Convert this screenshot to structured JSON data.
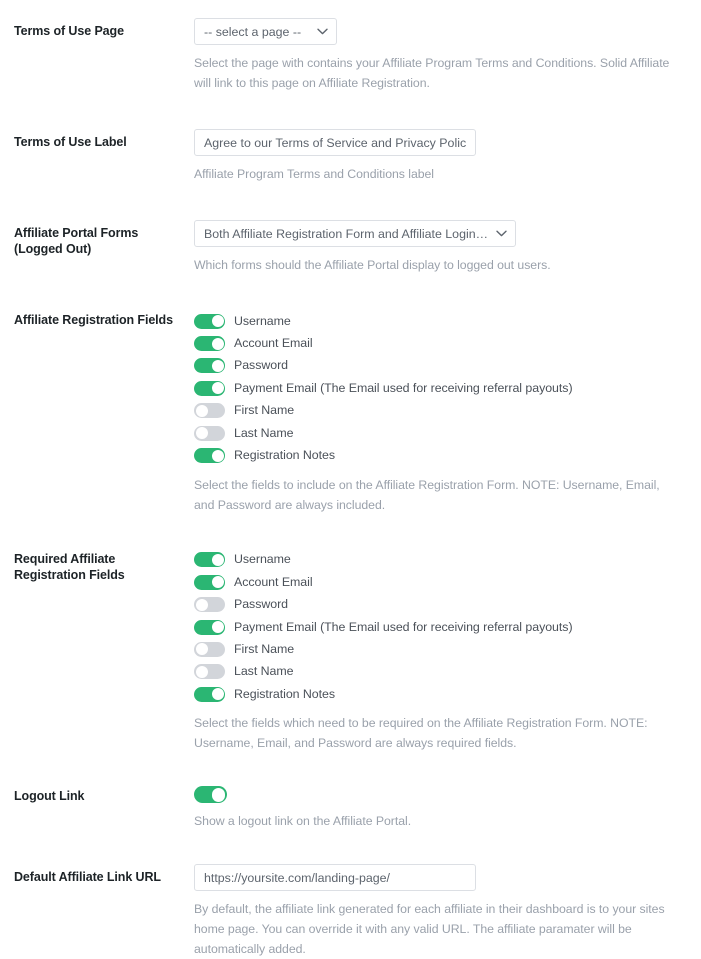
{
  "colors": {
    "toggle_on": "#2bb673",
    "toggle_off": "#d2d5da",
    "label": "#1d2327",
    "description": "#9aa1ab",
    "border": "#dcdfe4"
  },
  "fields": {
    "terms_of_use_page": {
      "label": "Terms of Use Page",
      "select_value": "-- select a page --",
      "description": "Select the page with contains your Affiliate Program Terms and Conditions. Solid Affiliate will link to this page on Affiliate Registration."
    },
    "terms_of_use_label": {
      "label": "Terms of Use Label",
      "value": "Agree to our Terms of Service and Privacy Policy",
      "description": "Affiliate Program Terms and Conditions label"
    },
    "affiliate_portal_forms": {
      "label": "Affiliate Portal Forms (Logged Out)",
      "label_line1": "Affiliate Portal Forms",
      "label_line2": "(Logged Out)",
      "select_value": "Both Affiliate Registration Form and Affiliate Login Form",
      "description": "Which forms should the Affiliate Portal display to logged out users."
    },
    "affiliate_registration_fields": {
      "label": "Affiliate Registration Fields",
      "description": "Select the fields to include on the Affiliate Registration Form. NOTE: Username, Email, and Password are always included.",
      "toggles": [
        {
          "label": "Username",
          "on": true
        },
        {
          "label": "Account Email",
          "on": true
        },
        {
          "label": "Password",
          "on": true
        },
        {
          "label": "Payment Email (The Email used for receiving referral payouts)",
          "on": true
        },
        {
          "label": "First Name",
          "on": false
        },
        {
          "label": "Last Name",
          "on": false
        },
        {
          "label": "Registration Notes",
          "on": true
        }
      ]
    },
    "required_affiliate_registration_fields": {
      "label": "Required Affiliate Registration Fields",
      "label_line1": "Required Affiliate",
      "label_line2": "Registration Fields",
      "description": "Select the fields which need to be required on the Affiliate Registration Form. NOTE: Username, Email, and Password are always required fields.",
      "toggles": [
        {
          "label": "Username",
          "on": true
        },
        {
          "label": "Account Email",
          "on": true
        },
        {
          "label": "Password",
          "on": false
        },
        {
          "label": "Payment Email (The Email used for receiving referral payouts)",
          "on": true
        },
        {
          "label": "First Name",
          "on": false
        },
        {
          "label": "Last Name",
          "on": false
        },
        {
          "label": "Registration Notes",
          "on": true
        }
      ]
    },
    "logout_link": {
      "label": "Logout Link",
      "on": true,
      "description": "Show a logout link on the Affiliate Portal."
    },
    "default_affiliate_link_url": {
      "label": "Default Affiliate Link URL",
      "value": "https://yoursite.com/landing-page/",
      "description": "By default, the affiliate link generated for each affiliate in their dashboard is to your sites home page. You can override it with any valid URL. The affiliate paramater will be automatically added."
    }
  }
}
